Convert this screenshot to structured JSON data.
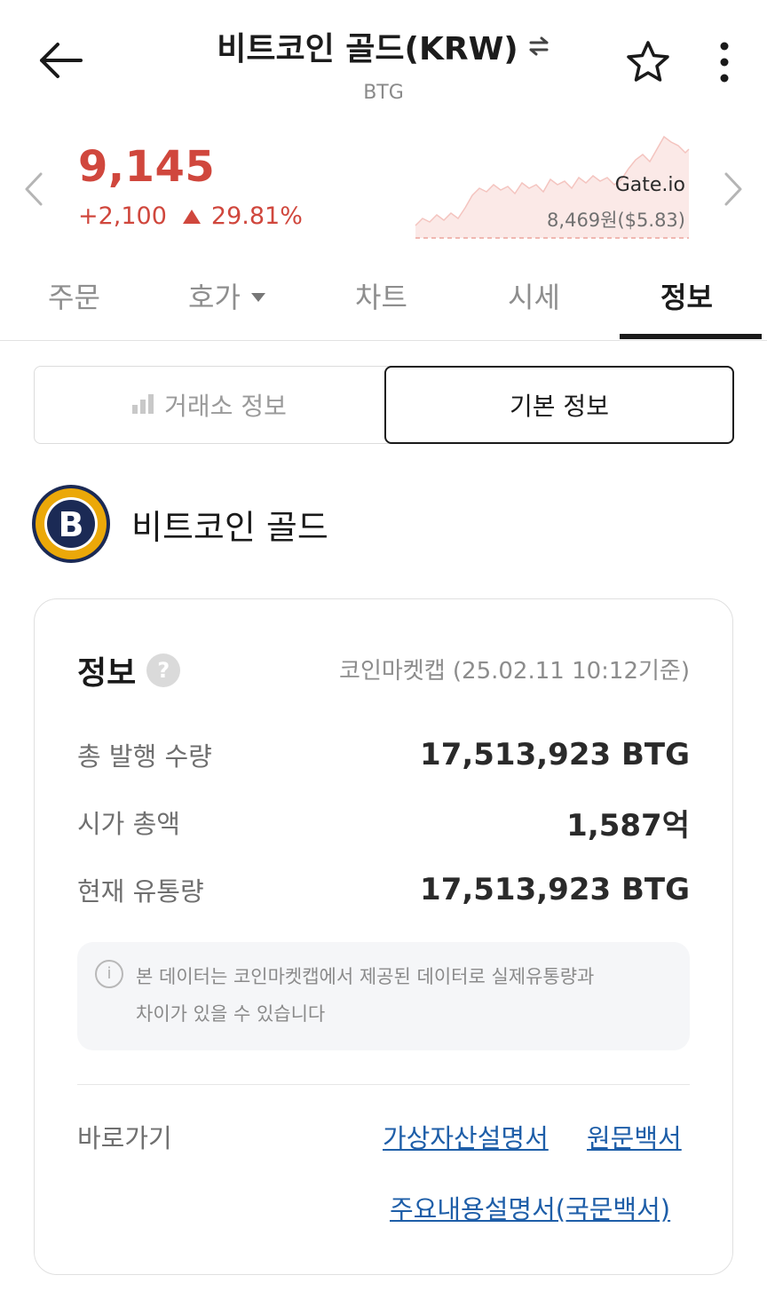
{
  "header": {
    "title": "비트코인 골드(KRW)",
    "subtitle": "BTG"
  },
  "icons": {
    "back": "back-arrow-icon",
    "swap": "swap-arrows-icon",
    "favorite": "star-outline-icon",
    "more": "more-vertical-icon",
    "prev": "chevron-left-icon",
    "next": "chevron-right-icon",
    "help": "question-circle-icon",
    "info": "info-circle-icon",
    "exchange_bars": "bar-chart-icon"
  },
  "price": {
    "current": "9,145",
    "change": "+2,100",
    "change_pct": "29.81%",
    "color_up": "#d0473d"
  },
  "exchange": {
    "name": "Gate.io",
    "price": "8,469원($5.83)"
  },
  "tabs": [
    {
      "label": "주문"
    },
    {
      "label": "호가"
    },
    {
      "label": "차트"
    },
    {
      "label": "시세"
    },
    {
      "label": "정보"
    }
  ],
  "segmented": {
    "left": "거래소 정보",
    "right": "기본 정보"
  },
  "coin": {
    "name": "비트코인 골드",
    "logo_letter": "B"
  },
  "info": {
    "title": "정보",
    "help": "?",
    "source": "코인마켓캡 (25.02.11 10:12기준)",
    "rows": [
      {
        "label": "총 발행 수량",
        "value": "17,513,923 BTG"
      },
      {
        "label": "시가 총액",
        "value": "1,587억"
      },
      {
        "label": "현재 유통량",
        "value": "17,513,923 BTG"
      }
    ],
    "notice_icon": "i",
    "notice_line1": "본 데이터는 코인마켓캡에서 제공된 데이터로 실제유통량과",
    "notice_line2": "차이가 있을 수 있습니다",
    "shortcut_label": "바로가기",
    "links": {
      "virtual_asset_doc": "가상자산설명서",
      "whitepaper": "원문백서",
      "summary_doc": "주요내용설명서(국문백서)"
    }
  }
}
